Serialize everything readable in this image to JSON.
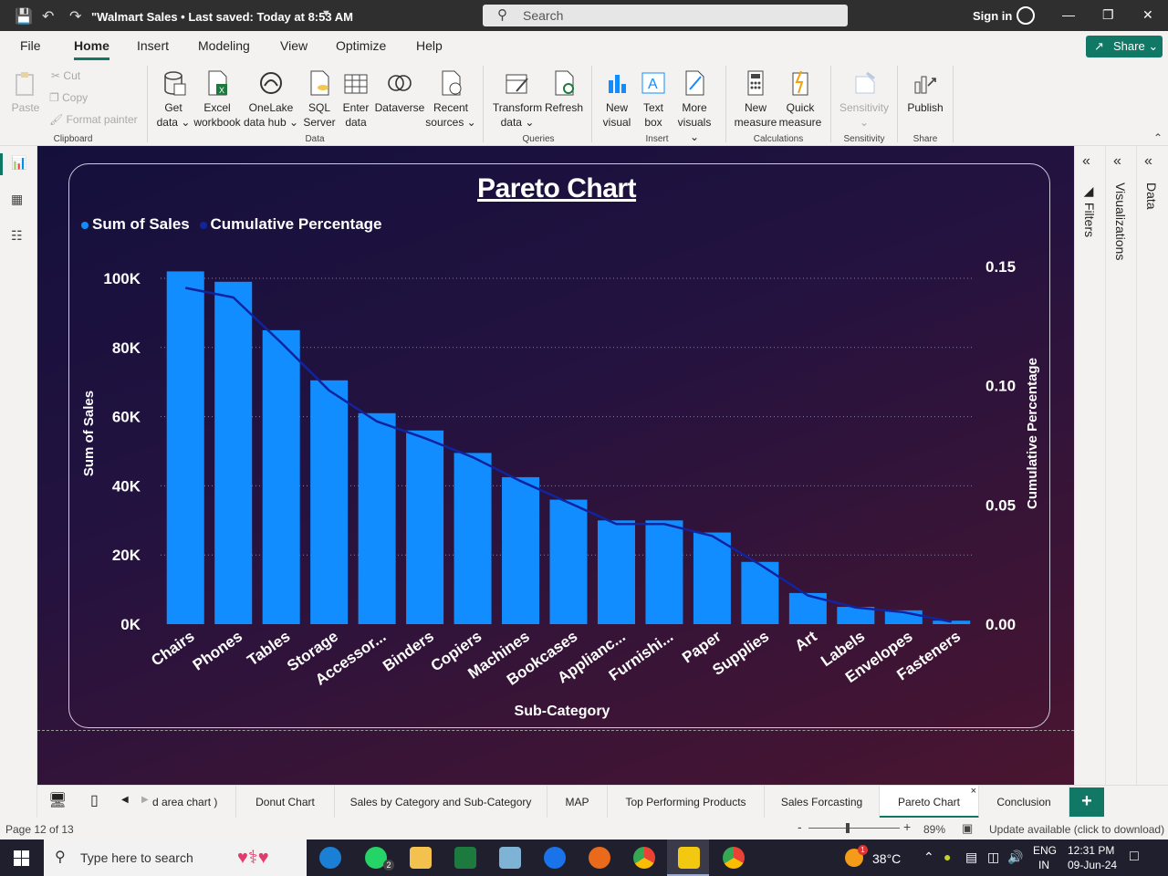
{
  "titlebar": {
    "doc_title": "\"Walmart Sales • Last saved: Today at 8:53 AM",
    "search_placeholder": "Search",
    "signin": "Sign in"
  },
  "menu": [
    "File",
    "Home",
    "Insert",
    "Modeling",
    "View",
    "Optimize",
    "Help"
  ],
  "share_label": "Share",
  "ribbon": {
    "clipboard": {
      "paste": "Paste",
      "cut": "Cut",
      "copy": "Copy",
      "format_painter": "Format painter",
      "group": "Clipboard"
    },
    "data": {
      "items": [
        {
          "l1": "Get",
          "l2": "data ⌄"
        },
        {
          "l1": "Excel",
          "l2": "workbook"
        },
        {
          "l1": "OneLake",
          "l2": "data hub ⌄"
        },
        {
          "l1": "SQL",
          "l2": "Server"
        },
        {
          "l1": "Enter",
          "l2": "data"
        },
        {
          "l1": "Dataverse",
          "l2": ""
        },
        {
          "l1": "Recent",
          "l2": "sources ⌄"
        }
      ],
      "group": "Data"
    },
    "queries": {
      "items": [
        {
          "l1": "Transform",
          "l2": "data ⌄"
        },
        {
          "l1": "Refresh",
          "l2": ""
        }
      ],
      "group": "Queries"
    },
    "insert": {
      "items": [
        {
          "l1": "New",
          "l2": "visual"
        },
        {
          "l1": "Text",
          "l2": "box"
        },
        {
          "l1": "More",
          "l2": "visuals ⌄"
        }
      ],
      "group": "Insert"
    },
    "calculations": {
      "items": [
        {
          "l1": "New",
          "l2": "measure"
        },
        {
          "l1": "Quick",
          "l2": "measure"
        }
      ],
      "group": "Calculations"
    },
    "sensitivity": {
      "items": [
        {
          "l1": "Sensitivity",
          "l2": "⌄"
        }
      ],
      "group": "Sensitivity"
    },
    "share": {
      "items": [
        {
          "l1": "Publish",
          "l2": ""
        }
      ],
      "group": "Share"
    }
  },
  "right_panes": {
    "filters": "Filters",
    "visualizations": "Visualizations",
    "data": "Data"
  },
  "chart_data": {
    "type": "bar",
    "title": "Pareto Chart",
    "legend": [
      {
        "name": "Sum of Sales",
        "color": "#118DFF"
      },
      {
        "name": "Cumulative Percentage",
        "color": "#12239E"
      }
    ],
    "xlabel": "Sub-Category",
    "ylabel": "Sum of Sales",
    "y2label": "Cumulative Percentage",
    "categories": [
      "Chairs",
      "Phones",
      "Tables",
      "Storage",
      "Accessor...",
      "Binders",
      "Copiers",
      "Machines",
      "Bookcases",
      "Applianc...",
      "Furnishi...",
      "Paper",
      "Supplies",
      "Art",
      "Labels",
      "Envelopes",
      "Fasteners"
    ],
    "series": [
      {
        "name": "Sum of Sales",
        "axis": "left",
        "values": [
          102000,
          99000,
          85000,
          70500,
          61000,
          56000,
          49500,
          42500,
          36000,
          30000,
          30000,
          26500,
          18000,
          9000,
          5000,
          4000,
          1000
        ]
      },
      {
        "name": "Cumulative Percentage",
        "axis": "right",
        "values": [
          0.141,
          0.137,
          0.118,
          0.098,
          0.085,
          0.078,
          0.07,
          0.06,
          0.051,
          0.042,
          0.042,
          0.037,
          0.025,
          0.012,
          0.007,
          0.005,
          0.001
        ]
      }
    ],
    "ylim": [
      0,
      100000
    ],
    "y_ticks": [
      "0K",
      "20K",
      "40K",
      "60K",
      "80K",
      "100K"
    ],
    "y2lim": [
      0,
      0.15
    ],
    "y2_ticks": [
      "0.00",
      "0.05",
      "0.10",
      "0.15"
    ],
    "grid": true,
    "legend_position": "top-left"
  },
  "page_tabs": [
    {
      "label": "d area chart )",
      "active": false
    },
    {
      "label": "Donut Chart",
      "active": false
    },
    {
      "label": "Sales by Category and Sub-Category",
      "active": false
    },
    {
      "label": "MAP",
      "active": false
    },
    {
      "label": "Top Performing Products",
      "active": false
    },
    {
      "label": "Sales Forcasting",
      "active": false
    },
    {
      "label": "Pareto Chart",
      "active": true
    },
    {
      "label": "Conclusion",
      "active": false
    }
  ],
  "status": {
    "page": "Page 12 of 13",
    "zoom": "89%",
    "update": "Update available (click to download)"
  },
  "taskbar": {
    "search_placeholder": "Type here to search",
    "weather": "38°C",
    "lang1": "ENG",
    "lang2": "IN",
    "time": "12:31 PM",
    "date": "09-Jun-24",
    "badge_whatsapp": "2",
    "badge_weather": "1"
  }
}
